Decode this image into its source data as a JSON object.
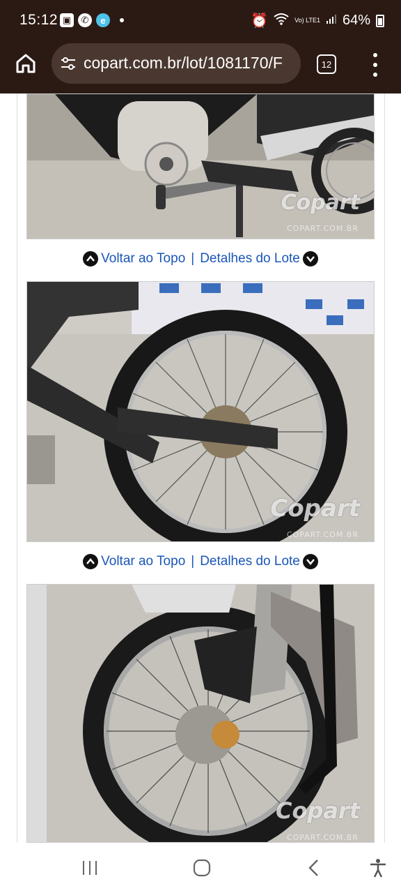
{
  "status_bar": {
    "time": "15:12",
    "battery": "64%",
    "network": "Vo) LTE1"
  },
  "browser": {
    "url": "copart.com.br/lot/1081170/F",
    "tab_count": "12"
  },
  "page": {
    "nav_links": {
      "top": "Voltar ao Topo",
      "separator": "|",
      "details": "Detalhes do Lote"
    },
    "watermark": "Copart",
    "watermark_sub": "COPART.COM.BR"
  },
  "icons": [
    "home-icon",
    "tune-icon",
    "tabs-icon",
    "more-vert-icon",
    "recents-icon",
    "home-nav-icon",
    "back-icon",
    "accessibility-icon"
  ]
}
